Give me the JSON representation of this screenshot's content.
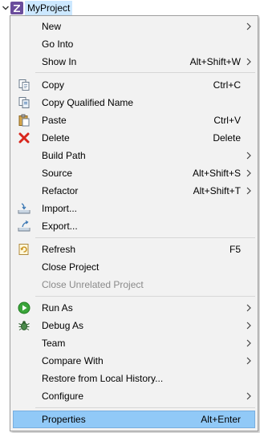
{
  "tree": {
    "project_label": "MyProject",
    "project_icon": "project-z-icon",
    "twisty_icon": "chevron-down-icon"
  },
  "menu": {
    "items": [
      {
        "label": "New",
        "shortcut": "",
        "submenu": true,
        "icon": ""
      },
      {
        "label": "Go Into",
        "shortcut": "",
        "submenu": false,
        "icon": ""
      },
      {
        "label": "Show In",
        "shortcut": "Alt+Shift+W",
        "submenu": true,
        "icon": ""
      },
      {
        "label": "Copy",
        "shortcut": "Ctrl+C",
        "submenu": false,
        "icon": "copy-icon"
      },
      {
        "label": "Copy Qualified Name",
        "shortcut": "",
        "submenu": false,
        "icon": "copy-qualified-name-icon"
      },
      {
        "label": "Paste",
        "shortcut": "Ctrl+V",
        "submenu": false,
        "icon": "paste-icon"
      },
      {
        "label": "Delete",
        "shortcut": "Delete",
        "submenu": false,
        "icon": "delete-icon"
      },
      {
        "label": "Build Path",
        "shortcut": "",
        "submenu": true,
        "icon": ""
      },
      {
        "label": "Source",
        "shortcut": "Alt+Shift+S",
        "submenu": true,
        "icon": ""
      },
      {
        "label": "Refactor",
        "shortcut": "Alt+Shift+T",
        "submenu": true,
        "icon": ""
      },
      {
        "label": "Import...",
        "shortcut": "",
        "submenu": false,
        "icon": "import-icon"
      },
      {
        "label": "Export...",
        "shortcut": "",
        "submenu": false,
        "icon": "export-icon"
      },
      {
        "label": "Refresh",
        "shortcut": "F5",
        "submenu": false,
        "icon": "refresh-icon"
      },
      {
        "label": "Close Project",
        "shortcut": "",
        "submenu": false,
        "icon": ""
      },
      {
        "label": "Close Unrelated Project",
        "shortcut": "",
        "submenu": false,
        "icon": "",
        "disabled": true
      },
      {
        "label": "Run As",
        "shortcut": "",
        "submenu": true,
        "icon": "run-icon"
      },
      {
        "label": "Debug As",
        "shortcut": "",
        "submenu": true,
        "icon": "debug-icon"
      },
      {
        "label": "Team",
        "shortcut": "",
        "submenu": true,
        "icon": ""
      },
      {
        "label": "Compare With",
        "shortcut": "",
        "submenu": true,
        "icon": ""
      },
      {
        "label": "Restore from Local History...",
        "shortcut": "",
        "submenu": false,
        "icon": ""
      },
      {
        "label": "Configure",
        "shortcut": "",
        "submenu": true,
        "icon": ""
      },
      {
        "label": "Properties",
        "shortcut": "Alt+Enter",
        "submenu": false,
        "icon": "",
        "selected": true
      }
    ]
  },
  "colors": {
    "menu_bg": "#f2f2f2",
    "selection_bg": "#91c9f7",
    "tree_selection_bg": "#cce8ff",
    "disabled_text": "#8a8a8a",
    "project_icon_purple": "#6a4c9c"
  }
}
